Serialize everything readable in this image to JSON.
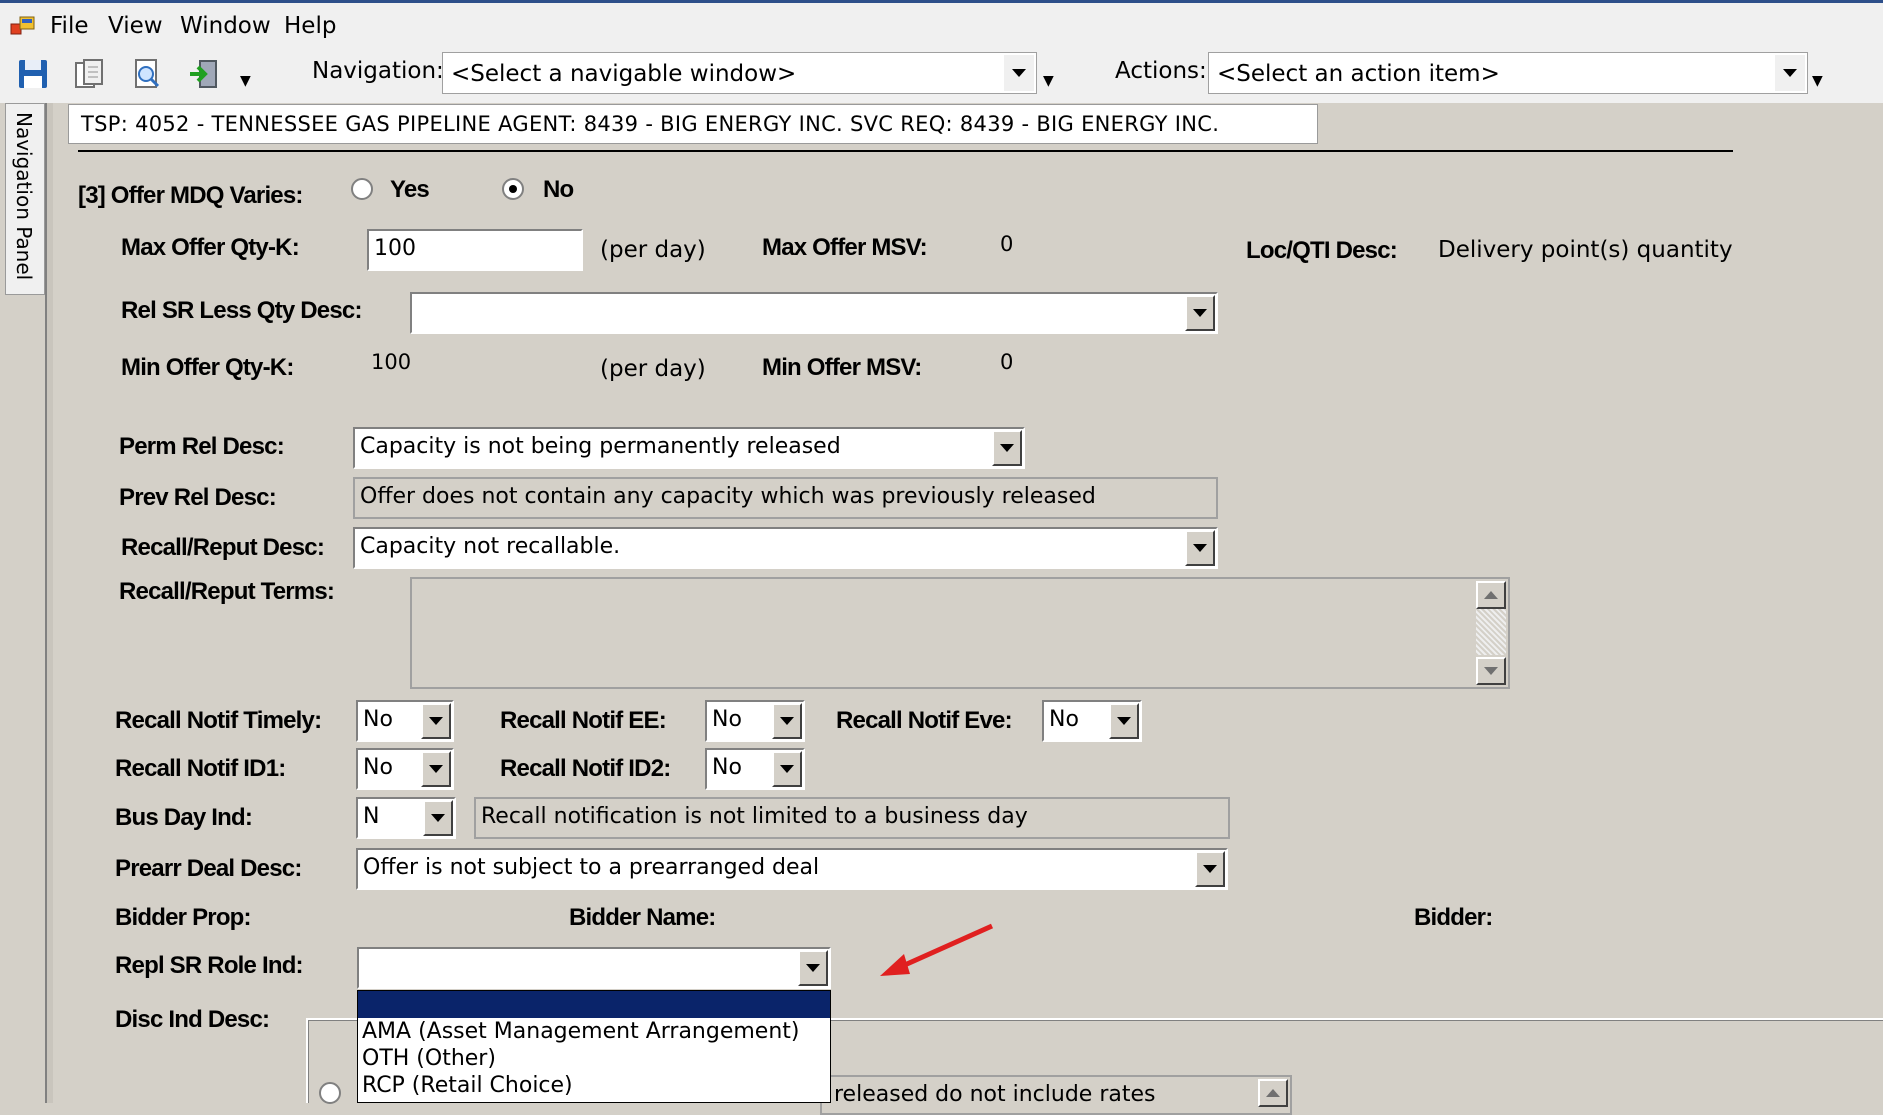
{
  "menu": {
    "file": "File",
    "view": "View",
    "window": "Window",
    "help": "Help"
  },
  "toolbar": {
    "navigation_label": "Navigation:",
    "navigation_value": "<Select a navigable window>",
    "actions_label": "Actions:",
    "actions_value": "<Select an action item>"
  },
  "nav_panel": {
    "label": "Navigation Panel"
  },
  "info_bar": {
    "text": "TSP:  4052 - TENNESSEE GAS PIPELINE   AGENT:  8439 - BIG ENERGY INC.   SVC REQ:  8439 - BIG ENERGY INC."
  },
  "form": {
    "offer_mdq_varies": {
      "label": "[3] Offer MDQ Varies:",
      "yes": "Yes",
      "no": "No",
      "selected": "No"
    },
    "max_offer_qty": {
      "label": "Max Offer Qty-K:",
      "value": "100",
      "unit": "(per day)"
    },
    "max_offer_msv": {
      "label": "Max Offer MSV:",
      "value": "0"
    },
    "loc_qti_desc": {
      "label": "Loc/QTI Desc:",
      "value": "Delivery point(s) quantity"
    },
    "rel_sr_less_qty_desc": {
      "label": "Rel SR Less Qty Desc:",
      "value": ""
    },
    "min_offer_qty": {
      "label": "Min Offer Qty-K:",
      "value": "100",
      "unit": "(per day)"
    },
    "min_offer_msv": {
      "label": "Min Offer MSV:",
      "value": "0"
    },
    "perm_rel_desc": {
      "label": "Perm Rel Desc:",
      "value": "Capacity is not being permanently released"
    },
    "prev_rel_desc": {
      "label": "Prev Rel Desc:",
      "value": "Offer does not contain any capacity which was previously released"
    },
    "recall_reput_desc": {
      "label": "Recall/Reput Desc:",
      "value": "Capacity not recallable."
    },
    "recall_reput_terms": {
      "label": "Recall/Reput Terms:",
      "value": ""
    },
    "recall_notif_timely": {
      "label": "Recall Notif Timely:",
      "value": "No"
    },
    "recall_notif_ee": {
      "label": "Recall Notif EE:",
      "value": "No"
    },
    "recall_notif_eve": {
      "label": "Recall Notif Eve:",
      "value": "No"
    },
    "recall_notif_id1": {
      "label": "Recall Notif ID1:",
      "value": "No"
    },
    "recall_notif_id2": {
      "label": "Recall Notif ID2:",
      "value": "No"
    },
    "bus_day_ind": {
      "label": "Bus Day Ind:",
      "value": "N",
      "desc": "Recall notification is not limited to a business day"
    },
    "prearr_deal_desc": {
      "label": "Prearr Deal Desc:",
      "value": "Offer is not subject to a prearranged deal"
    },
    "bidder_prop": {
      "label": "Bidder Prop:"
    },
    "bidder_name": {
      "label": "Bidder Name:"
    },
    "bidder": {
      "label": "Bidder:"
    },
    "repl_sr_role_ind": {
      "label": "Repl SR Role Ind:",
      "value": "",
      "options": [
        "",
        "AMA (Asset Management Arrangement)",
        "OTH (Other)",
        "RCP (Retail Choice)"
      ]
    },
    "disc_ind_desc": {
      "label": "Disc Ind Desc:"
    },
    "partial_text": "released do not include rates"
  },
  "annotation": {
    "arrow_color": "#e02020"
  }
}
